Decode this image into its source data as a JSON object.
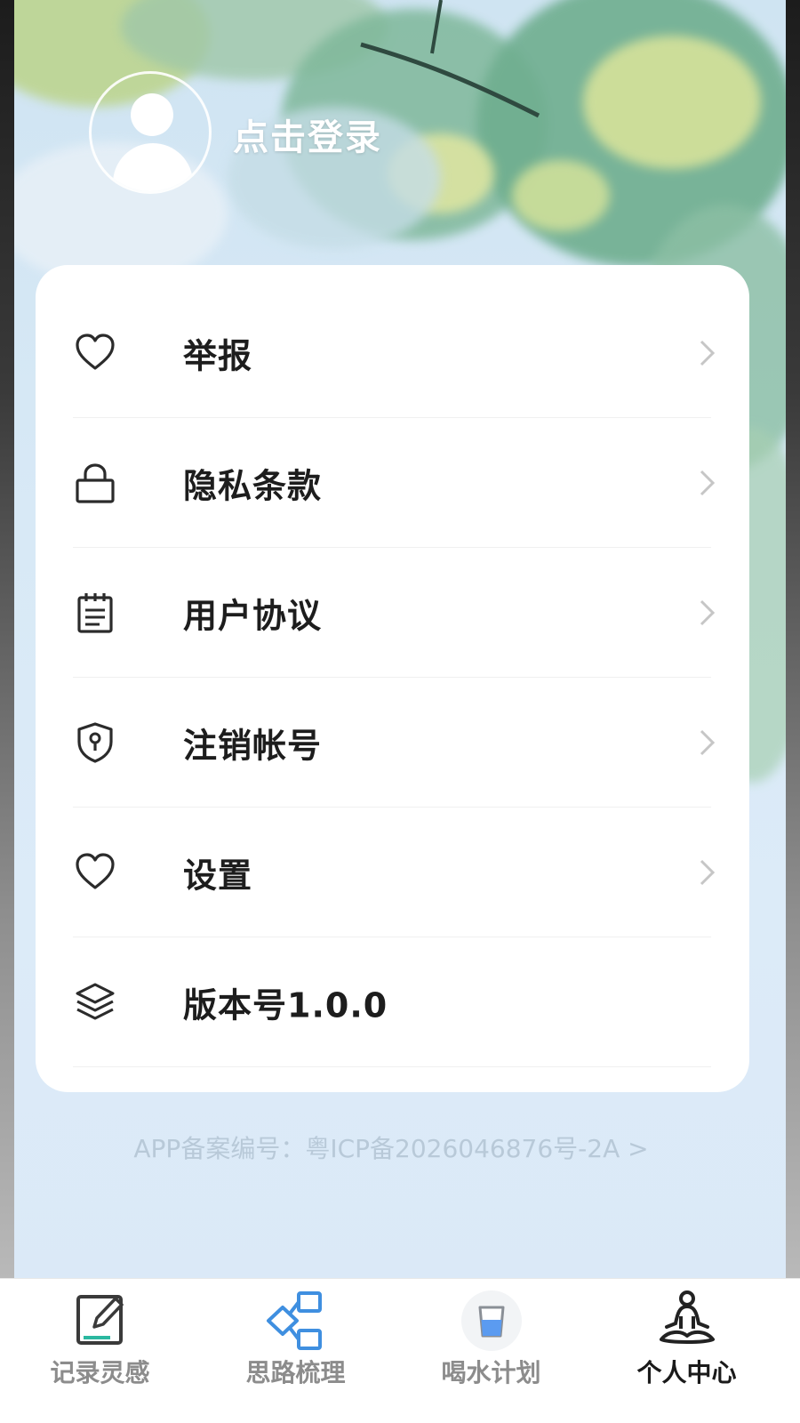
{
  "header": {
    "login_text": "点击登录"
  },
  "menu": {
    "items": [
      {
        "label": "举报",
        "icon": "heart-icon",
        "has_arrow": true
      },
      {
        "label": "隐私条款",
        "icon": "lock-icon",
        "has_arrow": true
      },
      {
        "label": "用户协议",
        "icon": "notepad-icon",
        "has_arrow": true
      },
      {
        "label": "注销帐号",
        "icon": "shield-keyhole-icon",
        "has_arrow": true
      },
      {
        "label": "设置",
        "icon": "heart-icon",
        "has_arrow": true
      },
      {
        "label": "版本号1.0.0",
        "icon": "layers-icon",
        "has_arrow": false
      }
    ]
  },
  "footer": {
    "icp_text": "APP备案编号：粤ICP备2026046876号-2A >"
  },
  "tabbar": {
    "tabs": [
      {
        "label": "记录灵感",
        "icon": "edit-note-icon",
        "active": false
      },
      {
        "label": "思路梳理",
        "icon": "mind-map-icon",
        "active": false
      },
      {
        "label": "喝水计划",
        "icon": "water-cup-icon",
        "active": false
      },
      {
        "label": "个人中心",
        "icon": "meditation-person-icon",
        "active": true
      }
    ]
  },
  "colors": {
    "accent_blue": "#3f8fe0",
    "text_primary": "#1d1d1d",
    "tab_inactive": "#8c8c8c",
    "icp_text": "#b8c9d8"
  }
}
